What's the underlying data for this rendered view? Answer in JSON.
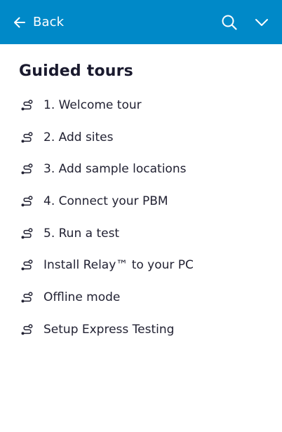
{
  "header": {
    "back_label": "Back",
    "back_icon": "arrow-left-icon",
    "search_icon": "search-icon",
    "menu_icon": "chevron-down-icon"
  },
  "section": {
    "title": "Guided tours"
  },
  "tours": [
    {
      "label": "1. Welcome tour",
      "icon": "route-icon"
    },
    {
      "label": "2. Add sites",
      "icon": "route-icon"
    },
    {
      "label": "3. Add sample locations",
      "icon": "route-icon"
    },
    {
      "label": "4. Connect your PBM",
      "icon": "route-icon"
    },
    {
      "label": "5. Run a test",
      "icon": "route-icon"
    },
    {
      "label": "Install Relay™ to your PC",
      "icon": "route-icon"
    },
    {
      "label": "Offline mode",
      "icon": "route-icon"
    },
    {
      "label": "Setup Express Testing",
      "icon": "route-icon"
    }
  ],
  "colors": {
    "header_bg": "#0089c8",
    "header_fg": "#ffffff",
    "text": "#222233",
    "title": "#1a1a2e"
  }
}
